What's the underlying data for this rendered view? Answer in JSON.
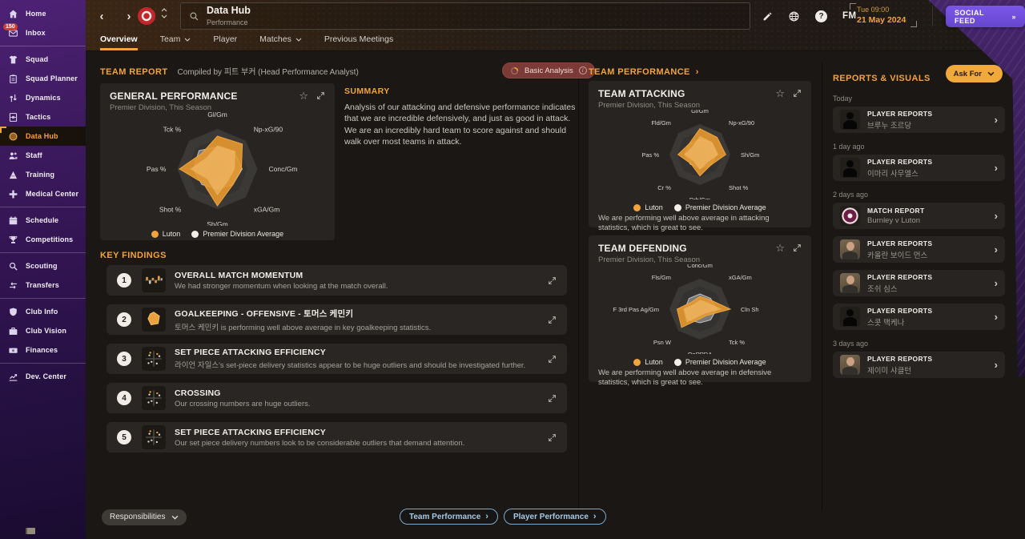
{
  "topbar": {
    "title": "Data Hub",
    "subtitle": "Performance",
    "time": "Tue 09:00",
    "date": "21 May 2024",
    "social_feed": "SOCIAL FEED",
    "fm": "FM",
    "help": "?"
  },
  "tabs": [
    {
      "label": "Overview",
      "active": true
    },
    {
      "label": "Team",
      "dropdown": true
    },
    {
      "label": "Player"
    },
    {
      "label": "Matches",
      "dropdown": true
    },
    {
      "label": "Previous Meetings"
    }
  ],
  "sidebar": {
    "items": [
      {
        "label": "Home",
        "icon": "home"
      },
      {
        "label": "Inbox",
        "icon": "inbox",
        "badge": "150",
        "divider_after": true
      },
      {
        "label": "Squad",
        "icon": "squad"
      },
      {
        "label": "Squad Planner",
        "icon": "squad-planner"
      },
      {
        "label": "Dynamics",
        "icon": "dynamics"
      },
      {
        "label": "Tactics",
        "icon": "tactics"
      },
      {
        "label": "Data Hub",
        "icon": "data-hub",
        "active": true
      },
      {
        "label": "Staff",
        "icon": "staff"
      },
      {
        "label": "Training",
        "icon": "training"
      },
      {
        "label": "Medical Center",
        "icon": "medical",
        "divider_after": true
      },
      {
        "label": "Schedule",
        "icon": "schedule"
      },
      {
        "label": "Competitions",
        "icon": "competitions",
        "divider_after": true
      },
      {
        "label": "Scouting",
        "icon": "scouting"
      },
      {
        "label": "Transfers",
        "icon": "transfers",
        "divider_after": true
      },
      {
        "label": "Club Info",
        "icon": "club-info"
      },
      {
        "label": "Club Vision",
        "icon": "club-vision"
      },
      {
        "label": "Finances",
        "icon": "finances",
        "divider_after": true
      },
      {
        "label": "Dev. Center",
        "icon": "dev-center"
      }
    ]
  },
  "team_report": {
    "title": "TEAM REPORT",
    "compiled_by": "Compiled by 피트 부커 (Head Performance Analyst)",
    "analysis_level": "Basic Analysis",
    "summary_title": "SUMMARY",
    "summary_text": "Analysis of our attacking and defensive performance indicates that we are incredible defensively, and just as good in attack. We are an incredibly hard team to score against and should walk over most teams in attack."
  },
  "key_findings": {
    "title": "KEY FINDINGS",
    "items": [
      {
        "num": "1",
        "icon": "momentum-chart",
        "title": "OVERALL MATCH MOMENTUM",
        "desc": "We had stronger momentum when looking at the match overall."
      },
      {
        "num": "2",
        "icon": "radar-chart",
        "title": "GOALKEEPING - OFFENSIVE - 토머스 케민키",
        "desc": "토머스 케민키 is performing well above average in key goalkeeping statistics."
      },
      {
        "num": "3",
        "icon": "scatter-chart",
        "title": "SET PIECE ATTACKING EFFICIENCY",
        "desc": "라이언 자일스's set-piece delivery statistics appear to be huge outliers and should be investigated further."
      },
      {
        "num": "4",
        "icon": "scatter-chart",
        "title": "CROSSING",
        "desc": "Our crossing numbers are huge outliers."
      },
      {
        "num": "5",
        "icon": "scatter-chart",
        "title": "SET PIECE ATTACKING EFFICIENCY",
        "desc": "Our set piece delivery numbers look to be considerable outliers that demand attention."
      }
    ]
  },
  "team_performance_header": "TEAM PERFORMANCE",
  "chart_data": [
    {
      "type": "radar",
      "title": "GENERAL PERFORMANCE",
      "subtitle": "Premier Division, This Season",
      "axes": [
        "Gl/Gm",
        "Np-xG/90",
        "Conc/Gm",
        "xGA/Gm",
        "Sh/Gm",
        "Shot %",
        "Pas %",
        "Tck %"
      ],
      "series": [
        {
          "name": "Luton",
          "values": [
            0.82,
            0.88,
            0.6,
            0.55,
            0.92,
            0.5,
            0.95,
            0.55
          ]
        },
        {
          "name": "Premier Division Average",
          "values": [
            0.55,
            0.6,
            0.62,
            0.55,
            0.5,
            0.55,
            0.6,
            0.65
          ]
        }
      ],
      "scale": [
        0,
        1
      ],
      "legend_position": "bottom",
      "note": null
    },
    {
      "type": "radar",
      "title": "TEAM ATTACKING",
      "subtitle": "Premier Division, This Season",
      "axes": [
        "Gl/Gm",
        "Np-xG/90",
        "Sh/Gm",
        "Shot %",
        "Drb/Gm",
        "Cr %",
        "Pas %",
        "Fld/Gm"
      ],
      "series": [
        {
          "name": "Luton",
          "values": [
            0.85,
            0.8,
            0.85,
            0.5,
            0.7,
            0.42,
            0.72,
            0.5
          ]
        },
        {
          "name": "Premier Division Average",
          "values": [
            0.5,
            0.55,
            0.55,
            0.5,
            0.45,
            0.45,
            0.5,
            0.5
          ]
        }
      ],
      "scale": [
        0,
        1
      ],
      "legend_position": "bottom",
      "note": "We are performing well above average in attacking statistics, which is great to see."
    },
    {
      "type": "radar",
      "title": "TEAM DEFENDING",
      "subtitle": "Premier Division, This Season",
      "axes": [
        "Conc/Gm",
        "xGA/Gm",
        "Cln Sh",
        "Tck %",
        "OpPPDA",
        "Psn W",
        "F 3rd Pas Ag/Gm",
        "Fls/Gm"
      ],
      "series": [
        {
          "name": "Luton",
          "values": [
            0.42,
            0.45,
            1.0,
            0.3,
            0.32,
            0.85,
            0.75,
            0.35
          ]
        },
        {
          "name": "Premier Division Average",
          "values": [
            0.5,
            0.5,
            0.55,
            0.5,
            0.45,
            0.5,
            0.5,
            0.5
          ]
        }
      ],
      "scale": [
        0,
        1
      ],
      "legend_position": "bottom",
      "note": "We are performing well above average in defensive statistics, which is great to see."
    }
  ],
  "reports": {
    "title": "REPORTS & VISUALS",
    "ask_for_label": "Ask For",
    "groups": [
      {
        "when": "Today",
        "items": [
          {
            "type": "PLAYER REPORTS",
            "name": "브루누 조르당",
            "avatar": "silhouette"
          }
        ]
      },
      {
        "when": "1 day ago",
        "items": [
          {
            "type": "PLAYER REPORTS",
            "name": "이마리 사무엘스",
            "avatar": "silhouette"
          }
        ]
      },
      {
        "when": "2 days ago",
        "items": [
          {
            "type": "MATCH REPORT",
            "name": "Burnley v Luton",
            "avatar": "badge"
          },
          {
            "type": "PLAYER REPORTS",
            "name": "카올란 보이드 먼스",
            "avatar": "photo"
          },
          {
            "type": "PLAYER REPORTS",
            "name": "조쉬 심스",
            "avatar": "photo"
          },
          {
            "type": "PLAYER REPORTS",
            "name": "스콧 맥케나",
            "avatar": "silhouette"
          }
        ]
      },
      {
        "when": "3 days ago",
        "items": [
          {
            "type": "PLAYER REPORTS",
            "name": "제이미 샤클턴",
            "avatar": "photo"
          }
        ]
      }
    ]
  },
  "footer": {
    "responsibilities": "Responsibilities",
    "team_performance": "Team Performance",
    "player_performance": "Player Performance"
  },
  "colors": {
    "accent_orange": "#f2a33c",
    "luton_series": "#e8992f",
    "average_series": "#f3efe7",
    "sidebar_purple": "#3f1b61",
    "social_feed_purple": "#6e4fd8",
    "analysis_red": "#7c3a36",
    "panel": "#272421",
    "background": "#1a1715",
    "cta_outline_blue": "#7fa9cc"
  }
}
